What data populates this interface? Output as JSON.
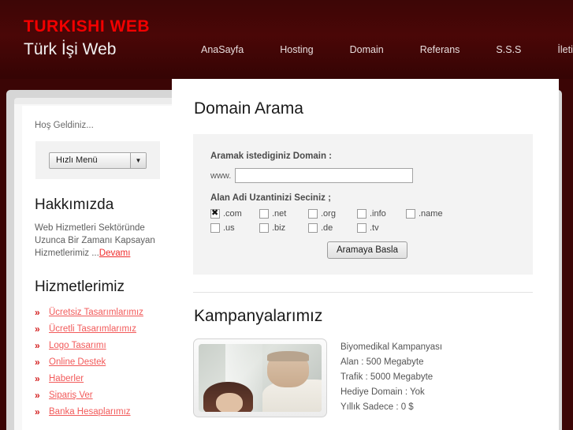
{
  "header": {
    "logo_top": "TURKISHI WEB",
    "logo_bottom": "Türk İşi Web",
    "nav": [
      {
        "label": "AnaSayfa"
      },
      {
        "label": "Hosting"
      },
      {
        "label": "Domain"
      },
      {
        "label": "Referans"
      },
      {
        "label": "S.S.S"
      },
      {
        "label": "İletişim"
      }
    ],
    "bg_color": "#4a0707",
    "logo_accent_color": "#f20000"
  },
  "sidebar": {
    "welcome": "Hoş Geldiniz...",
    "quick_menu": {
      "selected": "Hızlı Menü",
      "arrow_icon": "▼"
    },
    "about": {
      "title": "Hakkımızda",
      "text": "Web Hizmetleri Sektöründe Uzunca Bir Zamanı Kapsayan Hizmetlerimiz ...",
      "more_label": "Devamı"
    },
    "services": {
      "title": "Hizmetlerimiz",
      "bullet_icon": "»",
      "items": [
        {
          "label": "Ücretsiz Tasarımlarımız"
        },
        {
          "label": "Ücretli Tasarımlarımız"
        },
        {
          "label": "Logo Tasarımı"
        },
        {
          "label": "Online Destek"
        },
        {
          "label": "Haberler"
        },
        {
          "label": "Sipariş Ver"
        },
        {
          "label": "Banka Hesaplarımız"
        }
      ],
      "link_color": "#f25a5a"
    }
  },
  "main": {
    "domain_search": {
      "title": "Domain Arama",
      "field_label": "Aramak istediginiz Domain :",
      "www_prefix": "www.",
      "input_value": "",
      "input_placeholder": "",
      "ext_label": "Alan Adi Uzantinizi Seciniz ;",
      "extensions_row1": [
        {
          "label": ".com",
          "checked": true
        },
        {
          "label": ".net",
          "checked": false
        },
        {
          "label": ".org",
          "checked": false
        },
        {
          "label": ".info",
          "checked": false
        },
        {
          "label": ".name",
          "checked": false
        }
      ],
      "extensions_row2": [
        {
          "label": ".us",
          "checked": false
        },
        {
          "label": ".biz",
          "checked": false
        },
        {
          "label": ".de",
          "checked": false
        },
        {
          "label": ".tv",
          "checked": false
        }
      ],
      "submit_label": "Aramaya Basla"
    },
    "campaigns": {
      "title": "Kampanyalarımız",
      "item": {
        "name": "Biyomedikal Kampanyası",
        "alan": "Alan : 500 Megabyte",
        "trafik": "Trafik : 5000 Megabyte",
        "hediye": "Hediye Domain : Yok",
        "fiyat": "Yıllık Sadece : 0 $"
      }
    }
  }
}
